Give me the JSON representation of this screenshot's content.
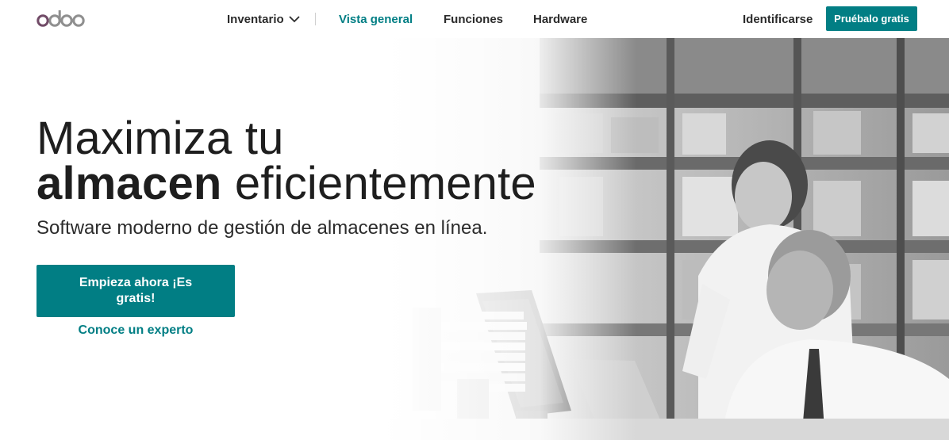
{
  "header": {
    "logo_text": "odoo",
    "nav": {
      "inventario": "Inventario",
      "vista_general": "Vista general",
      "funciones": "Funciones",
      "hardware": "Hardware"
    },
    "login": "Identificarse",
    "try_button": "Pruébalo gratis"
  },
  "hero": {
    "title_line1": "Maximiza tu",
    "title_bold": "almacen",
    "title_rest": " eficientemente",
    "subtitle": "Software moderno de gestión de almacenes en línea.",
    "cta_button": "Empieza ahora ¡Es gratis!",
    "expert_link": "Conoce un experto"
  },
  "colors": {
    "accent": "#017e84",
    "logo_purple": "#714b67",
    "logo_grey": "#8f8f8f"
  }
}
